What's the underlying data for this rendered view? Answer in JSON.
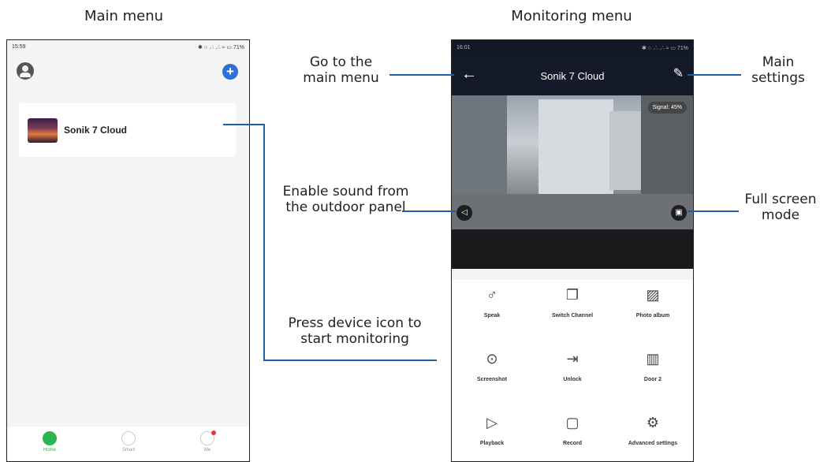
{
  "captions": {
    "main_menu": "Main menu",
    "monitoring_menu": "Monitoring menu"
  },
  "main_screen": {
    "status_time": "15:59",
    "status_icons": "✱ ○ .∴ .∴ ≈ ▭ 71%",
    "device_name": "Sonik 7 Cloud",
    "nav": [
      {
        "label": "Home",
        "icon": "home-icon"
      },
      {
        "label": "Smart",
        "icon": "smart-icon"
      },
      {
        "label": "Me",
        "icon": "me-icon"
      }
    ]
  },
  "monitor_screen": {
    "status_time": "16:01",
    "status_icons": "✱ ○ .∴ .∴ ≈ ▭ 71%",
    "title": "Sonik 7 Cloud",
    "signal": "Signal: 45%",
    "controls": [
      {
        "label": "Speak",
        "icon": "microphone-icon",
        "glyph": "♂"
      },
      {
        "label": "Switch Channel",
        "icon": "switch-channel-icon",
        "glyph": "❐"
      },
      {
        "label": "Photo album",
        "icon": "photo-album-icon",
        "glyph": "▨"
      },
      {
        "label": "Screenshot",
        "icon": "camera-icon",
        "glyph": "⊙"
      },
      {
        "label": "Unlock",
        "icon": "unlock-icon",
        "glyph": "⇥"
      },
      {
        "label": "Door 2",
        "icon": "door-icon",
        "glyph": "▥"
      },
      {
        "label": "Playback",
        "icon": "playback-icon",
        "glyph": "▷"
      },
      {
        "label": "Record",
        "icon": "record-icon",
        "glyph": "▢"
      },
      {
        "label": "Advanced settings",
        "icon": "gear-icon",
        "glyph": "⚙"
      }
    ]
  },
  "annotations": {
    "go_main_menu": "Go to the main menu",
    "main_settings": "Main settings",
    "enable_sound": "Enable sound from the outdoor panel",
    "full_screen": "Full screen mode",
    "press_device": "Press device icon to start monitoring"
  },
  "colors": {
    "accent_line": "#1f5ea8",
    "home_green": "#2fb34f",
    "add_blue": "#2f6fd6",
    "header_dark": "#141a28"
  }
}
